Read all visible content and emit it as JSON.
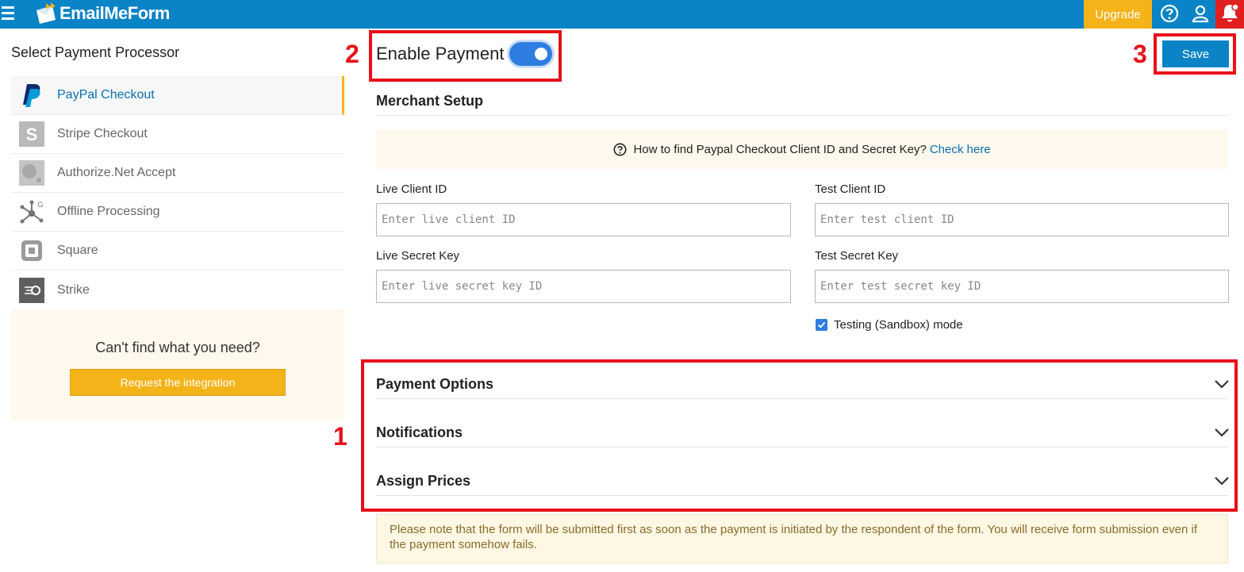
{
  "app": {
    "brand": "EmailMeForm"
  },
  "topbar": {
    "upgrade_label": "Upgrade"
  },
  "sidebar": {
    "title": "Select Payment Processor",
    "items": [
      {
        "label": "PayPal Checkout",
        "icon": "paypal-icon",
        "active": true
      },
      {
        "label": "Stripe Checkout",
        "icon": "stripe-icon",
        "active": false
      },
      {
        "label": "Authorize.Net Accept",
        "icon": "authorize-net-icon",
        "active": false
      },
      {
        "label": "Offline Processing",
        "icon": "offline-processing-icon",
        "active": false
      },
      {
        "label": "Square",
        "icon": "square-icon",
        "active": false
      },
      {
        "label": "Strike",
        "icon": "strike-icon",
        "active": false
      }
    ],
    "cant_find": "Can't find what you need?",
    "request_label": "Request the integration"
  },
  "main": {
    "enable_label": "Enable Payment",
    "enable_on": true,
    "save_label": "Save",
    "annotations": {
      "one": "1",
      "two": "2",
      "three": "3"
    },
    "merchant_title": "Merchant Setup",
    "info_text": "How to find Paypal Checkout Client ID and Secret Key?",
    "info_link": "Check here",
    "fields": {
      "live_client_label": "Live Client ID",
      "live_client_placeholder": "Enter live client ID",
      "test_client_label": "Test Client ID",
      "test_client_placeholder": "Enter test client ID",
      "live_secret_label": "Live Secret Key",
      "live_secret_placeholder": "Enter live secret key ID",
      "test_secret_label": "Test Secret Key",
      "test_secret_placeholder": "Enter test secret key ID"
    },
    "sandbox_label": "Testing (Sandbox) mode",
    "sandbox_checked": true,
    "sections": [
      "Payment Options",
      "Notifications",
      "Assign Prices"
    ],
    "note": "Please note that the form will be submitted first as soon as the payment is initiated by the respondent of the form. You will receive form submission even if the payment somehow fails."
  },
  "colors": {
    "topbar": "#0a84c6",
    "upgrade": "#f5b31a",
    "alert": "#e0201f",
    "annotation": "#e8101a",
    "toggle": "#2f7de0"
  }
}
